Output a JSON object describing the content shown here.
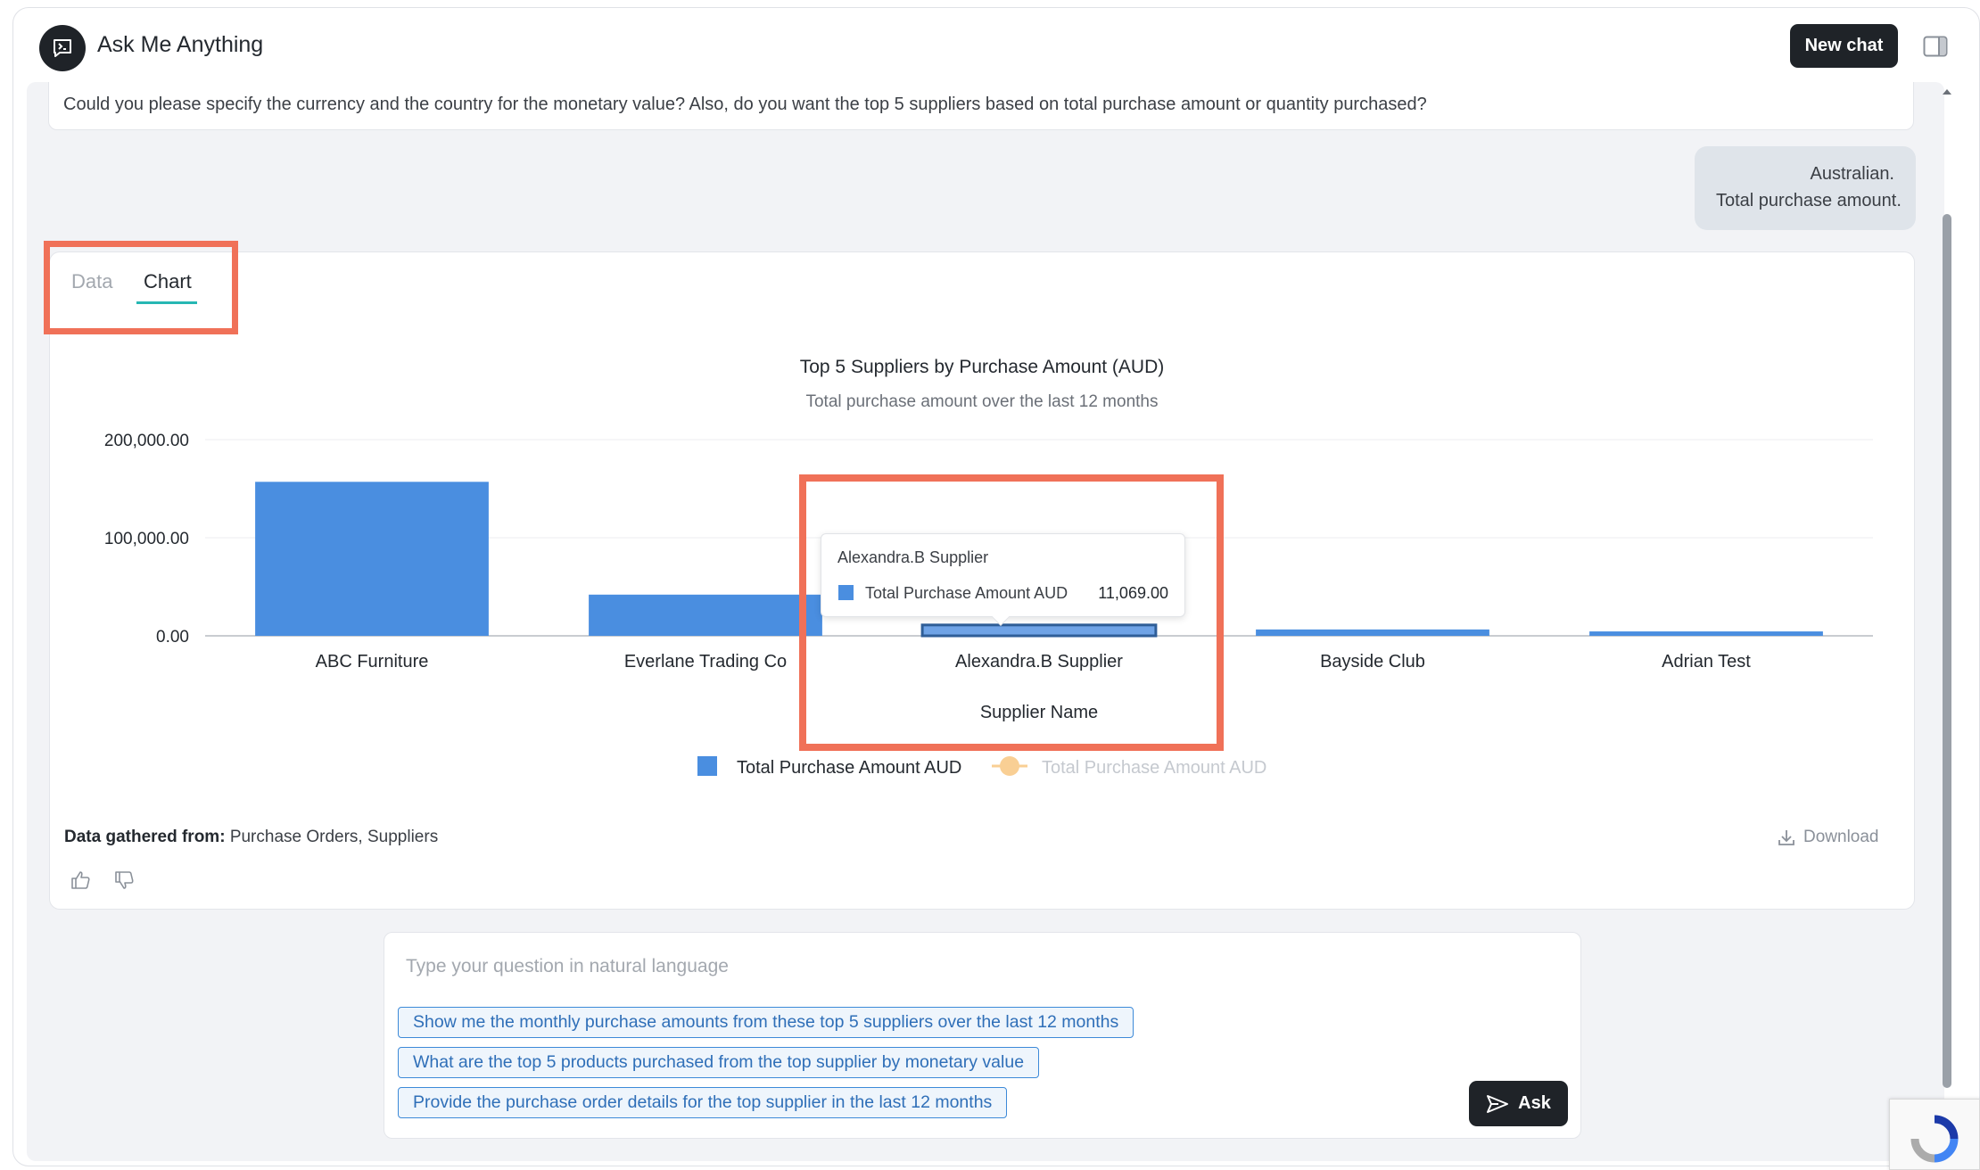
{
  "header": {
    "title": "Ask Me Anything",
    "new_chat_label": "New chat",
    "logo_icon": "chat-terminal-icon",
    "toggle_icon": "sidebar-toggle-icon"
  },
  "conversation": {
    "ai_message": "Could you please specify the currency and the country for the monetary value? Also, do you want the top 5 suppliers based on total purchase amount or quantity purchased?",
    "user_message_lines": [
      "Australian.",
      "Total purchase amount."
    ]
  },
  "result": {
    "tabs": [
      {
        "label": "Data",
        "active": false
      },
      {
        "label": "Chart",
        "active": true
      }
    ],
    "source_label": "Data gathered from:",
    "source_value": "Purchase Orders, Suppliers",
    "download_label": "Download"
  },
  "chart_data": {
    "type": "bar",
    "title": "Top 5 Suppliers by Purchase Amount (AUD)",
    "subtitle": "Total purchase amount over the last 12 months",
    "xlabel": "Supplier Name",
    "ylabel": "",
    "categories": [
      "ABC Furniture",
      "Everlane Trading Co",
      "Alexandra.B Supplier",
      "Bayside Club",
      "Adrian Test"
    ],
    "series": [
      {
        "name": "Total Purchase Amount AUD",
        "values": [
          157000,
          42000,
          11069,
          6500,
          4500
        ],
        "color": "#4a8ee0"
      }
    ],
    "legend": [
      {
        "name": "Total Purchase Amount AUD",
        "type": "bar",
        "color": "#4a8ee0",
        "active": true
      },
      {
        "name": "Total Purchase Amount AUD",
        "type": "line",
        "color": "#f9cf94",
        "active": false
      }
    ],
    "yticks": [
      "0.00",
      "100,000.00",
      "200,000.00"
    ],
    "ylim": [
      0,
      200000
    ],
    "grid": true,
    "legend_position": "bottom-center",
    "tooltip": {
      "category": "Alexandra.B Supplier",
      "series": "Total Purchase Amount AUD",
      "value": "11,069.00"
    }
  },
  "composer": {
    "placeholder": "Type your question in natural language",
    "suggestions": [
      "Show me the monthly purchase amounts from these top 5 suppliers over the last 12 months",
      "What are the top 5 products purchased from the top supplier by monetary value",
      "Provide the purchase order details for the top supplier in the last 12 months"
    ],
    "ask_label": "Ask",
    "send_icon": "send-icon"
  },
  "colors": {
    "accent": "#26b7b3",
    "highlight": "#f07158",
    "bar": "#4a8ee0",
    "dark": "#1f2328"
  }
}
